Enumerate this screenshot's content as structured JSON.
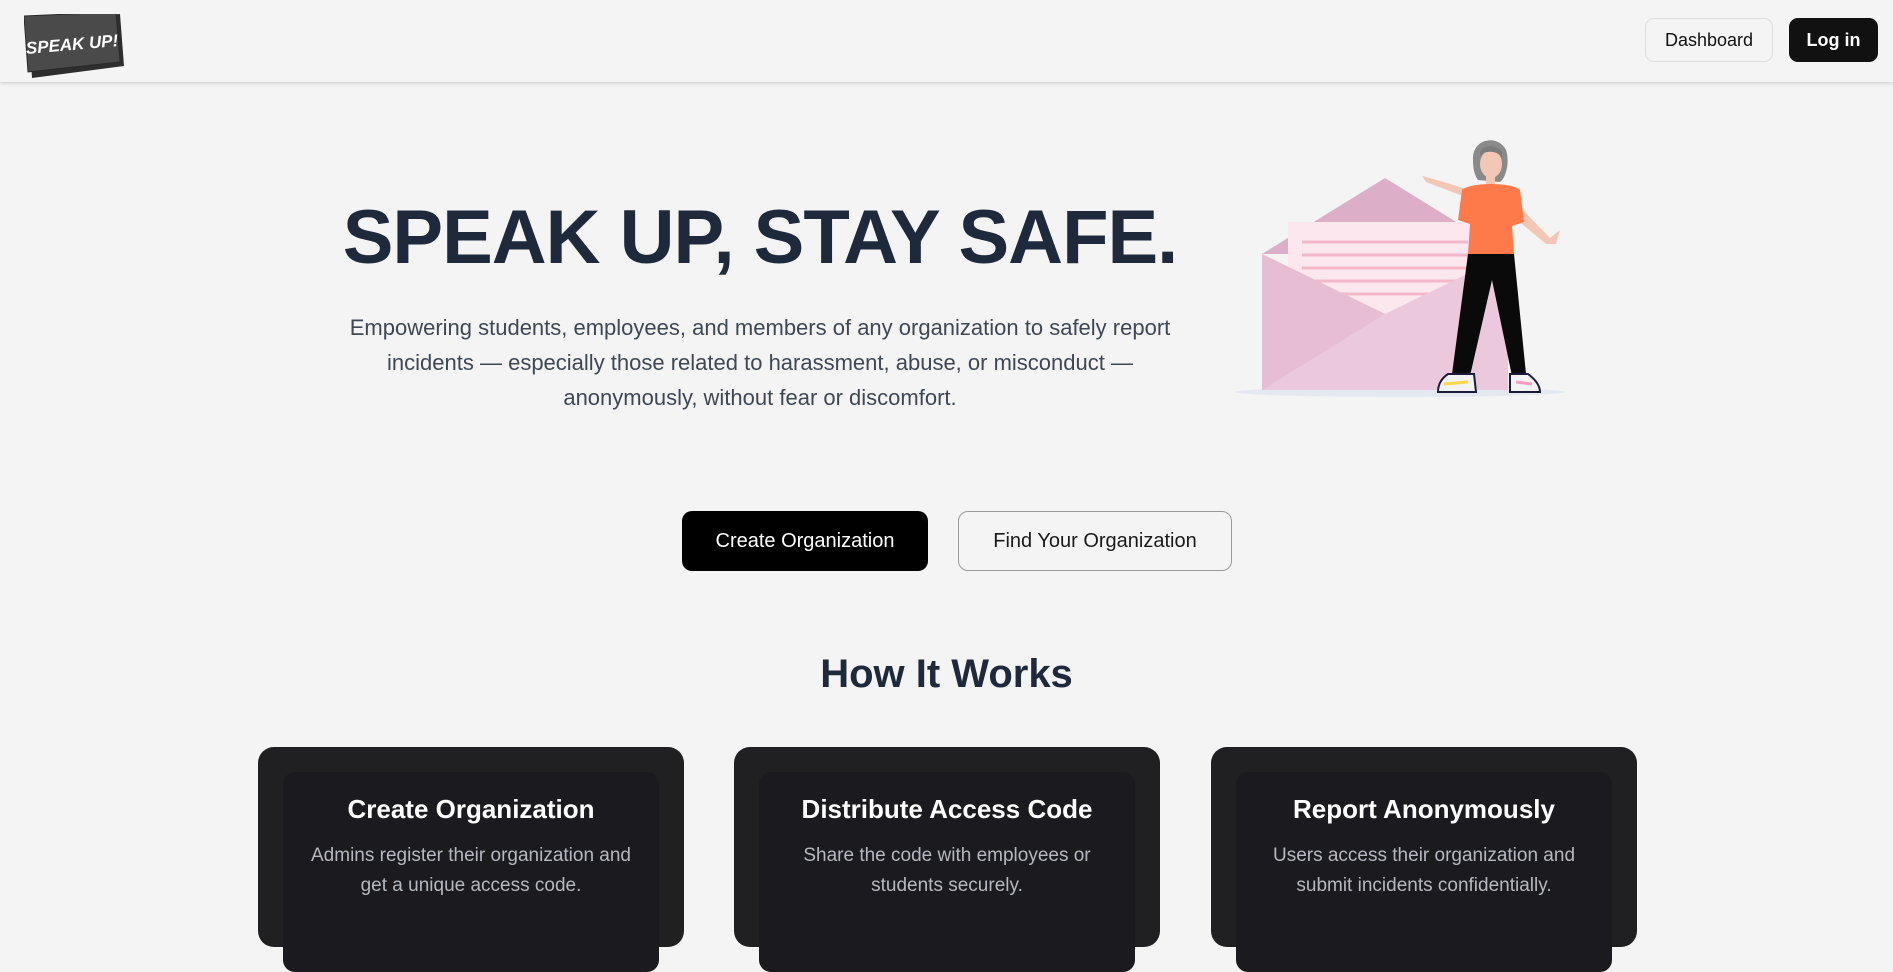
{
  "header": {
    "logo_text": "SPEAK UP!",
    "dashboard_label": "Dashboard",
    "login_label": "Log in"
  },
  "hero": {
    "title": "SPEAK UP, STAY SAFE.",
    "subtitle": "Empowering students, employees, and members of any organization to safely report incidents — especially those related to harassment, abuse, or misconduct — anonymously, without fear or discomfort.",
    "illustration_icon": "envelope-person-illustration"
  },
  "actions": {
    "create_label": "Create Organization",
    "find_label": "Find Your Organization"
  },
  "how_it_works": {
    "title": "How It Works",
    "steps": [
      {
        "title": "Create Organization",
        "description": "Admins register their organization and get a unique access code."
      },
      {
        "title": "Distribute Access Code",
        "description": "Share the code with employees or students securely."
      },
      {
        "title": "Report Anonymously",
        "description": "Users access their organization and submit incidents confidentially."
      }
    ]
  },
  "colors": {
    "background": "#f4f4f4",
    "primary": "#000000",
    "heading": "#1e293b",
    "card": "#202022",
    "illustration_accent": "#ff7a4a",
    "envelope": "#ecc8dc"
  }
}
